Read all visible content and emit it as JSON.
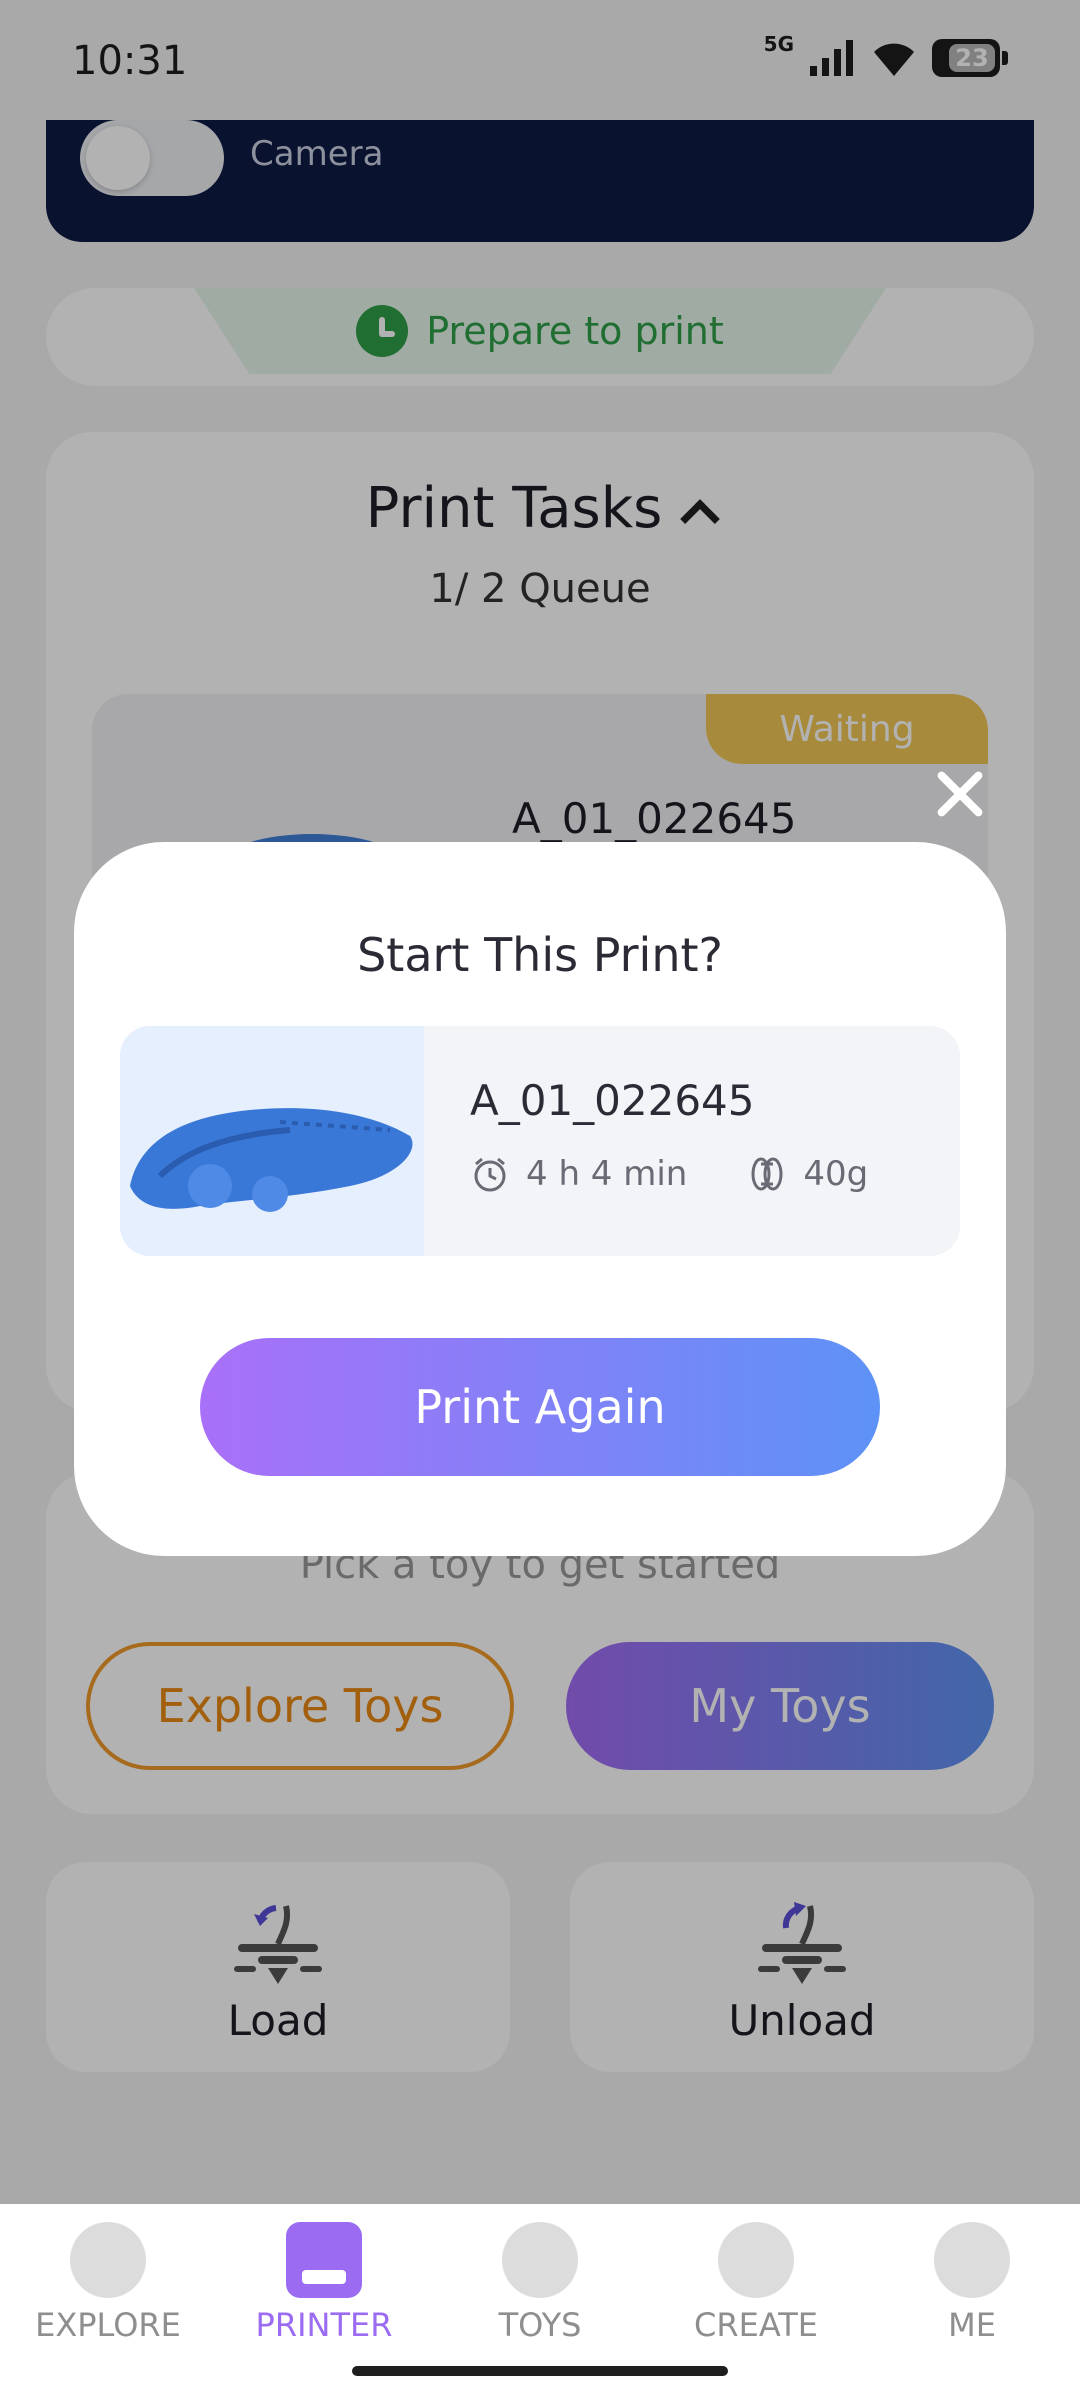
{
  "status_bar": {
    "time": "10:31",
    "network": "5G",
    "battery": "23"
  },
  "camera": {
    "label": "Camera",
    "enabled": false
  },
  "printer_status": {
    "text": "Prepare to print",
    "icon": "clock-icon",
    "color": "#2e9e48"
  },
  "print_tasks": {
    "title": "Print Tasks",
    "queue": "1/ 2 Queue",
    "items": [
      {
        "name": "A_01_022645",
        "status": "Waiting"
      }
    ]
  },
  "toys_panel": {
    "hint": "Pick a toy to get started",
    "explore_label": "Explore Toys",
    "my_toys_label": "My Toys"
  },
  "actions": {
    "load_label": "Load",
    "unload_label": "Unload"
  },
  "modal": {
    "title": "Start This Print?",
    "model_name": "A_01_022645",
    "duration": "4 h 4 min",
    "weight": "40g",
    "button_label": "Print Again"
  },
  "bottom_nav": {
    "items": [
      {
        "label": "EXPLORE",
        "icon": "planet-icon"
      },
      {
        "label": "PRINTER",
        "icon": "printer-icon",
        "active": true
      },
      {
        "label": "TOYS",
        "icon": "bear-icon"
      },
      {
        "label": "CREATE",
        "icon": "lightbulb-icon"
      },
      {
        "label": "ME",
        "icon": "smiley-icon"
      }
    ]
  },
  "colors": {
    "accent": "#9b6cf1",
    "explore_orange": "#e88a15",
    "camera_card": "#0d1a44",
    "waiting": "#f0c655"
  }
}
